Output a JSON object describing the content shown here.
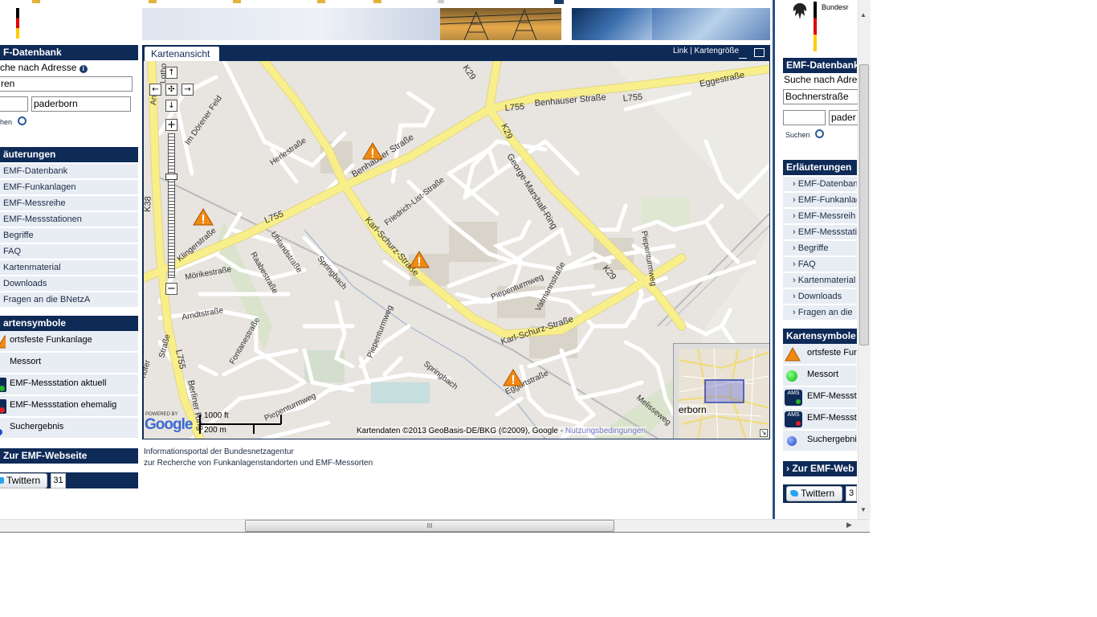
{
  "left_panel": {
    "emf_head": "F-Datenbank",
    "search_label": "che nach Adresse",
    "street_value": "ren",
    "plz_value": "",
    "city_value": "paderborn",
    "search_button": "hen",
    "expl_head": "äuterungen",
    "items": [
      "EMF-Datenbank",
      "EMF-Funkanlagen",
      "EMF-Messreihe",
      "EMF-Messstationen",
      "Begriffe",
      "FAQ",
      "Kartenmaterial",
      "Downloads",
      "Fragen an die BNetzA"
    ],
    "symbols_head": "artensymbole",
    "symbols": [
      "ortsfeste Funkanlage",
      "Messort",
      "EMF-Messstation aktuell",
      "EMF-Messstation ehemalig",
      "Suchergebnis"
    ],
    "website_link": "Zur EMF-Webseite",
    "twitter_label": "Twittern",
    "twitter_count": "31"
  },
  "map": {
    "title": "Kartenansicht",
    "link_label": "Link",
    "separator": "|",
    "size_label": "Kartengröße",
    "scale_ft": "1000 ft",
    "scale_m": "200 m",
    "attribution": "Kartendaten ©2013 GeoBasis-DE/BKG (©2009), Google -",
    "terms": "Nutzungsbedingungen",
    "powered_by": "POWERED BY",
    "google": "Google",
    "overview_label": "erborn",
    "streets": {
      "benhauser1": "Benhauser Straße",
      "benhauser2": "Benhauser Straße",
      "l755a": "L755",
      "l755b": "L755",
      "l755c": "L755",
      "l755d": "L755",
      "eggestrasse": "Eggestraße",
      "k29a": "K29",
      "k29b": "K29",
      "k29c": "K29",
      "k38": "K38",
      "george": "George-Marshall-Ring",
      "karl1": "Karl-Schurz-Straße",
      "karl2": "Karl-Schurz-Straße",
      "friedrich": "Friedrich-List-Straße",
      "herle": "Herlestraße",
      "doerener": "Im Dörener Feld",
      "klinger": "Klingerstraße",
      "uhland": "Uhlandstraße",
      "raabe": "Raabestraße",
      "moerike": "Mörikestraße",
      "arndt": "Arndtstraße",
      "fontane": "Fontanestraße",
      "springbach1": "Springbach",
      "springbach2": "Springbach",
      "piepen1": "Piepenturmweg",
      "piepen2": "Piepenturmweg",
      "piepen3": "Piepenturmweg",
      "piepen4": "Piepenturmweg",
      "vatmann": "Vatmannstraße",
      "eggert": "Eggertstraße",
      "berliner": "Berliner Ring",
      "melisse": "Melisseweg",
      "hofer": "hofer",
      "strasse": "Straße",
      "lotho": "Lotho",
      "an": "An"
    }
  },
  "footer": {
    "line1": "Informationsportal der Bundesnetzagentur",
    "line2": "zur Recherche von Funkanlagenstandorten und EMF-Messorten"
  },
  "right_panel": {
    "bundes_text": "Bundesr",
    "emf_head": "EMF-Datenbank",
    "search_label": "Suche nach Adre",
    "street_value": "Bochnerstraße",
    "plz_value": "",
    "city_value": "pader",
    "search_button": "Suchen",
    "expl_head": "Erläuterungen",
    "items": [
      "EMF-Datenban",
      "EMF-Funkanlag",
      "EMF-Messreih",
      "EMF-Messstati",
      "Begriffe",
      "FAQ",
      "Kartenmaterial",
      "Downloads",
      "Fragen an die"
    ],
    "symbols_head": "Kartensymbole",
    "symbols": [
      "ortsfeste Fur",
      "Messort",
      "EMF-Messsta",
      "EMF-Messsta",
      "Suchergebni"
    ],
    "ams_label": "AMS",
    "website_link": "Zur EMF-Web",
    "twitter_label": "Twittern",
    "twitter_count": "3"
  },
  "scrollbar": {
    "grip": "III"
  },
  "colors": {
    "navy": "#0e2a57",
    "road_yellow": "#f8ef8a",
    "map_bg": "#e8e4df"
  }
}
